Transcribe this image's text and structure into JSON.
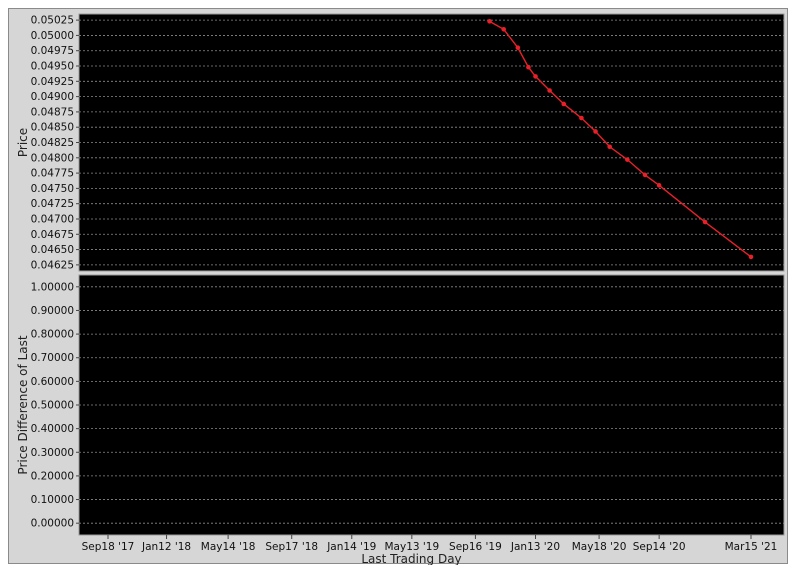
{
  "chart_data": [
    {
      "type": "line",
      "ylabel": "Price",
      "xlabel": "",
      "ylim": [
        0.04615,
        0.05035
      ],
      "yticks": [
        "0.05025",
        "0.05000",
        "0.04975",
        "0.04950",
        "0.04925",
        "0.04900",
        "0.04875",
        "0.04850",
        "0.04825",
        "0.04800",
        "0.04775",
        "0.04750",
        "0.04725",
        "0.04700",
        "0.04675",
        "0.04650",
        "0.04625"
      ],
      "grid": true,
      "series": [
        {
          "color": "#e8202a",
          "points": [
            {
              "x": "2019-10-14",
              "y": 0.05023
            },
            {
              "x": "2019-11-11",
              "y": 0.0501
            },
            {
              "x": "2019-12-09",
              "y": 0.0498
            },
            {
              "x": "2019-12-30",
              "y": 0.04948
            },
            {
              "x": "2020-01-13",
              "y": 0.04933
            },
            {
              "x": "2020-02-10",
              "y": 0.0491
            },
            {
              "x": "2020-03-09",
              "y": 0.04888
            },
            {
              "x": "2020-04-13",
              "y": 0.04865
            },
            {
              "x": "2020-05-11",
              "y": 0.04843
            },
            {
              "x": "2020-06-08",
              "y": 0.04818
            },
            {
              "x": "2020-07-13",
              "y": 0.04797
            },
            {
              "x": "2020-08-17",
              "y": 0.04772
            },
            {
              "x": "2020-09-14",
              "y": 0.04755
            },
            {
              "x": "2020-12-14",
              "y": 0.04695
            },
            {
              "x": "2021-03-15",
              "y": 0.04638
            }
          ]
        }
      ]
    },
    {
      "type": "line",
      "ylabel": "Price Difference of Last",
      "xlabel": "Last Trading Day",
      "ylim": [
        -0.05,
        1.05
      ],
      "yticks": [
        "1.00000",
        "0.90000",
        "0.80000",
        "0.70000",
        "0.60000",
        "0.50000",
        "0.40000",
        "0.30000",
        "0.20000",
        "0.10000",
        "0.00000"
      ],
      "xticks": [
        {
          "date": "2017-09-18",
          "label": "Sep18 '17"
        },
        {
          "date": "2018-01-12",
          "label": "Jan12 '18"
        },
        {
          "date": "2018-05-14",
          "label": "May14 '18"
        },
        {
          "date": "2018-09-17",
          "label": "Sep17 '18"
        },
        {
          "date": "2019-01-14",
          "label": "Jan14 '19"
        },
        {
          "date": "2019-05-13",
          "label": "May13 '19"
        },
        {
          "date": "2019-09-16",
          "label": "Sep16 '19"
        },
        {
          "date": "2020-01-13",
          "label": "Jan13 '20"
        },
        {
          "date": "2020-05-18",
          "label": "May18 '20"
        },
        {
          "date": "2020-09-14",
          "label": "Sep14 '20"
        },
        {
          "date": "2021-03-15",
          "label": "Mar15 '21"
        }
      ],
      "grid": true,
      "series": []
    }
  ]
}
